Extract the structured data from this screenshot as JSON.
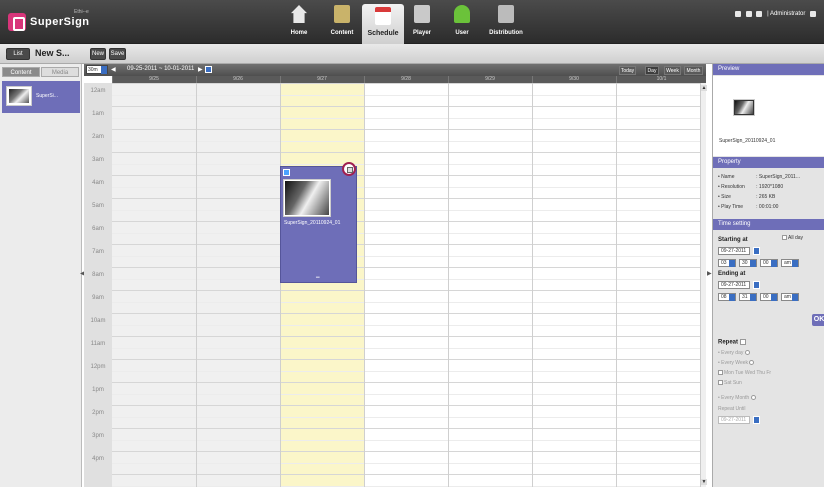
{
  "header": {
    "logo_sub": "Ethi--e",
    "logo_text": "SuperSign",
    "nav": [
      {
        "label": "Home",
        "icon": "home-icon",
        "color": "#e8e8e8"
      },
      {
        "label": "Content",
        "icon": "content-icon",
        "color": "#c9b36a"
      },
      {
        "label": "Schedule",
        "icon": "schedule-icon",
        "color": "#d93a3a"
      },
      {
        "label": "Player",
        "icon": "player-icon",
        "color": "#c9c9c9"
      },
      {
        "label": "User",
        "icon": "user-icon",
        "color": "#6bc23a"
      },
      {
        "label": "Distribution",
        "icon": "distribution-icon",
        "color": "#bbbbbb"
      }
    ],
    "active_nav": "Schedule",
    "user": "| Administrator"
  },
  "toolbar": {
    "list_label": "List",
    "title": "New S...",
    "new_label": "New",
    "save_label": "Save"
  },
  "left_panel": {
    "tab_content": "Content",
    "tab_media": "Media",
    "item_label": "SuperSi..."
  },
  "calendar": {
    "interval": "30m",
    "date_range": "09-25-2011 ~ 10-01-2011",
    "view_buttons": {
      "today": "Today",
      "day": "Day",
      "week": "Week",
      "month": "Month"
    },
    "days": [
      "9/25",
      "9/26",
      "9/27",
      "9/28",
      "9/29",
      "9/30",
      "10/1"
    ],
    "highlight_day": "9/27",
    "times": [
      "12am",
      "1am",
      "2am",
      "3am",
      "4am",
      "5am",
      "6am",
      "7am",
      "8am",
      "9am",
      "10am",
      "11am",
      "12pm",
      "1pm",
      "2pm",
      "3pm",
      "4pm"
    ],
    "event": {
      "label": "SuperSign_20110924_01"
    }
  },
  "right_panel": {
    "preview_title": "Preview",
    "preview_name": "SuperSign_20110924_01",
    "property_title": "Property",
    "properties": {
      "name_label": "Name",
      "name_value": "SuperSign_2011...",
      "resolution_label": "Resolution",
      "resolution_value": "1920*1080",
      "size_label": "Size",
      "size_value": "265 KB",
      "playtime_label": "Play Time",
      "playtime_value": "00:01:00"
    },
    "time_title": "Time setting",
    "starting_at": "Starting at",
    "all_day": "All day",
    "start_date": "09-27-2011",
    "start_hour": "03",
    "start_min": "30",
    "start_sec": "00",
    "start_ampm": "am",
    "ending_at": "Ending at",
    "end_date": "09-27-2011",
    "end_hour": "08",
    "end_min": "31",
    "end_sec": "00",
    "end_ampm": "am",
    "ok": "OK",
    "repeat": "Repeat",
    "every_day": "Every day",
    "every_week": "Every Week",
    "weekdays_1": "Mon  Tue  Wed  Thu  Fr",
    "weekdays_2": "Sat  Sun",
    "every_month": "Every Month",
    "repeat_until": "Repeat Until",
    "repeat_until_date": "09-27-2011"
  }
}
